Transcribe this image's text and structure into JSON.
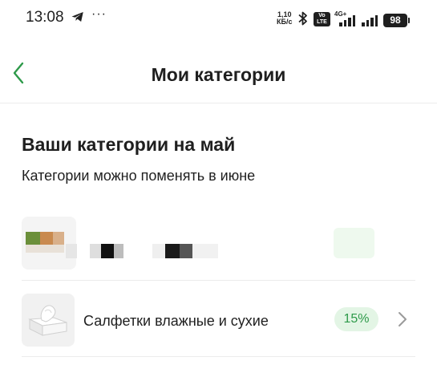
{
  "status_bar": {
    "time": "13:08",
    "more": "···",
    "net_speed_value": "1,10",
    "net_speed_unit": "КБ/с",
    "volte_top": "Vo",
    "volte_bottom": "LTE",
    "signal_label": "4G+",
    "battery": "98"
  },
  "header": {
    "title": "Мои категории"
  },
  "main": {
    "section_title": "Ваши категории на май",
    "section_subtitle": "Категории можно поменять в июне",
    "categories": [
      {
        "name": "Салфетки влажные и сухие",
        "cashback": "15%",
        "icon": "napkins-icon"
      }
    ]
  },
  "colors": {
    "accent_green": "#2e9a4a",
    "badge_bg": "#e3f5e5",
    "text": "#1f1f1f",
    "divider": "#ececec"
  }
}
